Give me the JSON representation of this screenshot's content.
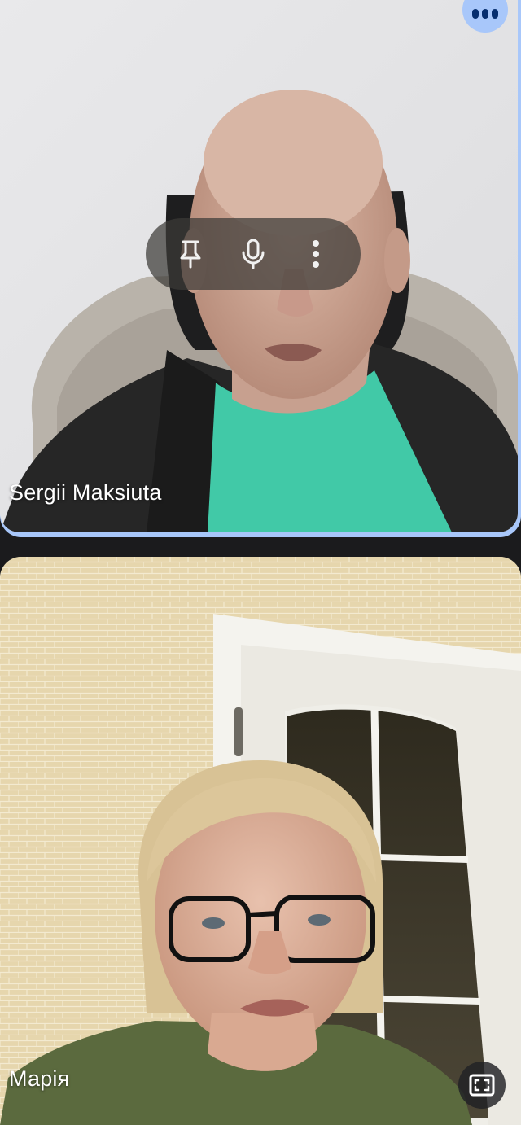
{
  "participants": [
    {
      "name": "Sergii Maksiuta",
      "active_speaker": true,
      "controls": [
        {
          "icon": "pin-icon"
        },
        {
          "icon": "mic-icon"
        },
        {
          "icon": "more-vert-icon"
        }
      ]
    },
    {
      "name": "Марія",
      "active_speaker": false,
      "controls": [
        {
          "icon": "fullscreen-icon"
        }
      ]
    }
  ],
  "top_bar": {
    "more_icon": "more-horiz-icon"
  },
  "colors": {
    "background": "#1b1b1d",
    "active_speaker_border": "#a8c7fa",
    "more_button_bg": "#a8c7fa",
    "more_button_fg": "#062e6f"
  }
}
